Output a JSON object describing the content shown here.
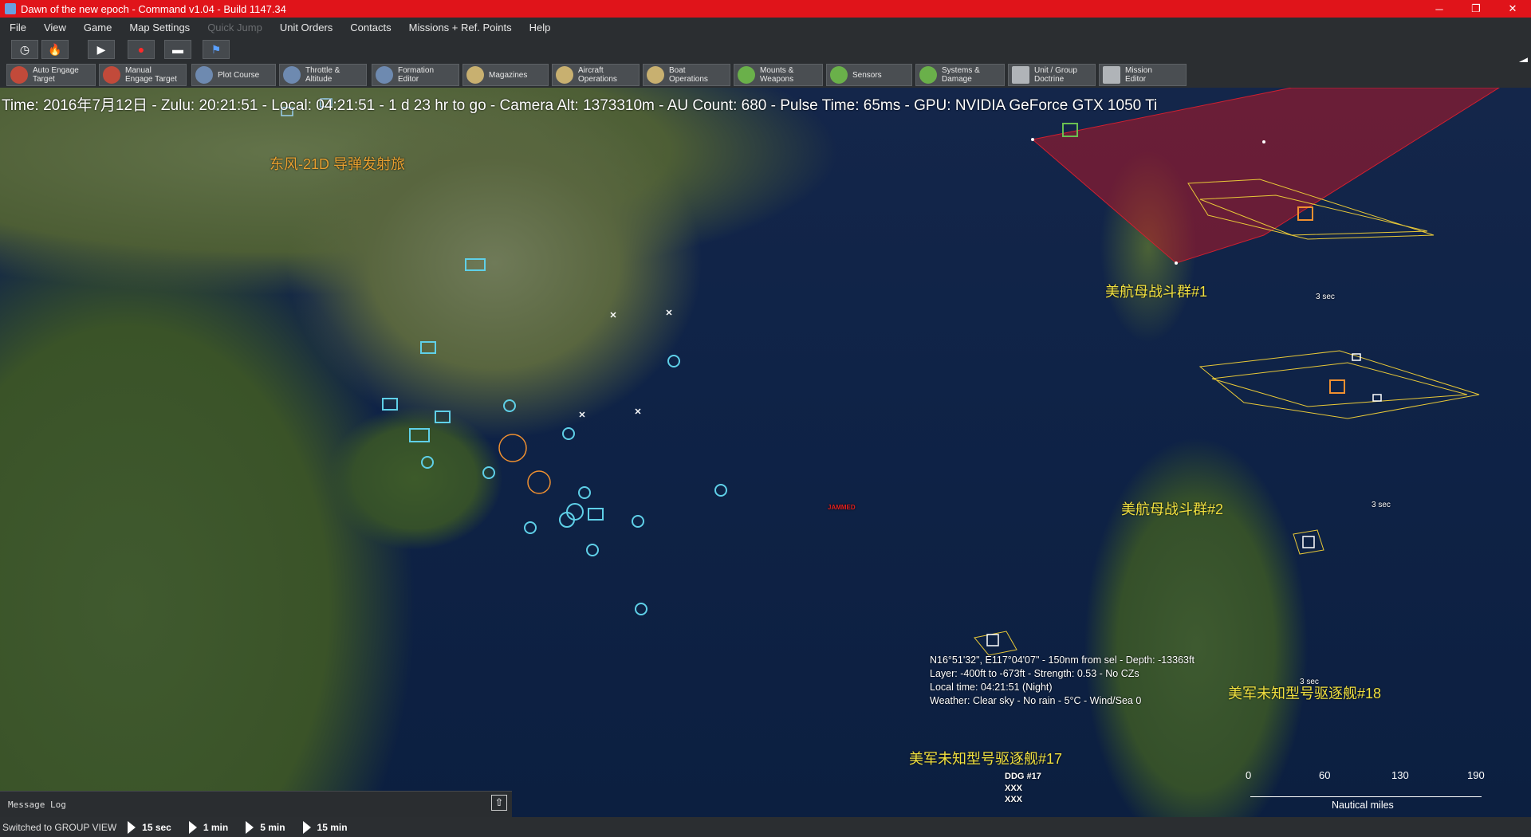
{
  "window": {
    "title": "Dawn of the new epoch - Command v1.04 - Build 1147.34",
    "minimize": "─",
    "maximize": "❐",
    "close": "✕"
  },
  "menu": [
    "File",
    "View",
    "Game",
    "Map Settings",
    "Quick Jump",
    "Unit Orders",
    "Contacts",
    "Missions + Ref. Points",
    "Help"
  ],
  "menu_disabled": [
    "Quick Jump"
  ],
  "toolbar1_icons": [
    "clock-icon",
    "fire-icon",
    "play-icon",
    "record-icon",
    "bridge-icon",
    "flag-icon"
  ],
  "toolbar1_glyphs": [
    "◷",
    "🔥",
    "▶",
    "●",
    "▬",
    "⚑"
  ],
  "toolbar2": [
    {
      "label": "Auto Engage\nTarget",
      "icon": "crosshair-icon"
    },
    {
      "label": "Manual\nEngage Target",
      "icon": "crosshair-icon"
    },
    {
      "label": "Plot Course",
      "icon": "plot-course-icon"
    },
    {
      "label": "Throttle &\nAltitude",
      "icon": "throttle-icon"
    },
    {
      "label": "Formation\nEditor",
      "icon": "formation-icon"
    },
    {
      "label": "Magazines",
      "icon": "magazines-icon"
    },
    {
      "label": "Aircraft\nOperations",
      "icon": "aircraft-icon"
    },
    {
      "label": "Boat\nOperations",
      "icon": "boat-icon"
    },
    {
      "label": "Mounts &\nWeapons",
      "icon": "weapons-icon"
    },
    {
      "label": "Sensors",
      "icon": "sensors-icon"
    },
    {
      "label": "Systems &\nDamage",
      "icon": "systems-gear-icon"
    },
    {
      "label": "Unit / Group\nDoctrine",
      "icon": "doctrine-icon"
    },
    {
      "label": "Mission\nEditor",
      "icon": "mission-editor-icon"
    }
  ],
  "hud": "Time: 2016年7月12日 - Zulu: 20:21:51 - Local: 04:21:51 - 1 d 23 hr to go -  Camera Alt: 1373310m  - AU Count: 680 - Pulse Time: 65ms - GPU: NVIDIA GeForce GTX 1050 Ti",
  "map_labels": {
    "df21d": "东风-21D 导弹发射旅",
    "csg1": "美航母战斗群#1",
    "csg2": "美航母战斗群#2",
    "ddg18": "美军未知型号驱逐舰#18",
    "ddg17": "美军未知型号驱逐舰#17",
    "ddg17_unit": "DDG #17",
    "ddg17_tag": "XXX",
    "ddg17_tag2": "XXX",
    "three_sec": "3 sec",
    "jammed": "JAMMED"
  },
  "info": {
    "line1": "N16°51'32\", E117°04'07\" - 150nm from sel - Depth: -13363ft",
    "line2": "Layer: -400ft to -673ft - Strength: 0.53 - No CZs",
    "line3": "Local time: 04:21:51 (Night)",
    "line4": "Weather: Clear sky - No rain - 5°C - Wind/Sea 0"
  },
  "scale": {
    "ticks": [
      "0",
      "60",
      "130",
      "190"
    ],
    "unit": "Nautical miles"
  },
  "message_log": {
    "label": "Message Log",
    "expand_icon": "⇧"
  },
  "status": {
    "text": "Switched to GROUP VIEW",
    "speeds": [
      "15 sec",
      "1 min",
      "5 min",
      "15 min"
    ]
  },
  "colors": {
    "titlebar": "#e0141a",
    "friendly": "#5fd0e8",
    "hostile": "#f0c040",
    "zone": "#c01820"
  }
}
